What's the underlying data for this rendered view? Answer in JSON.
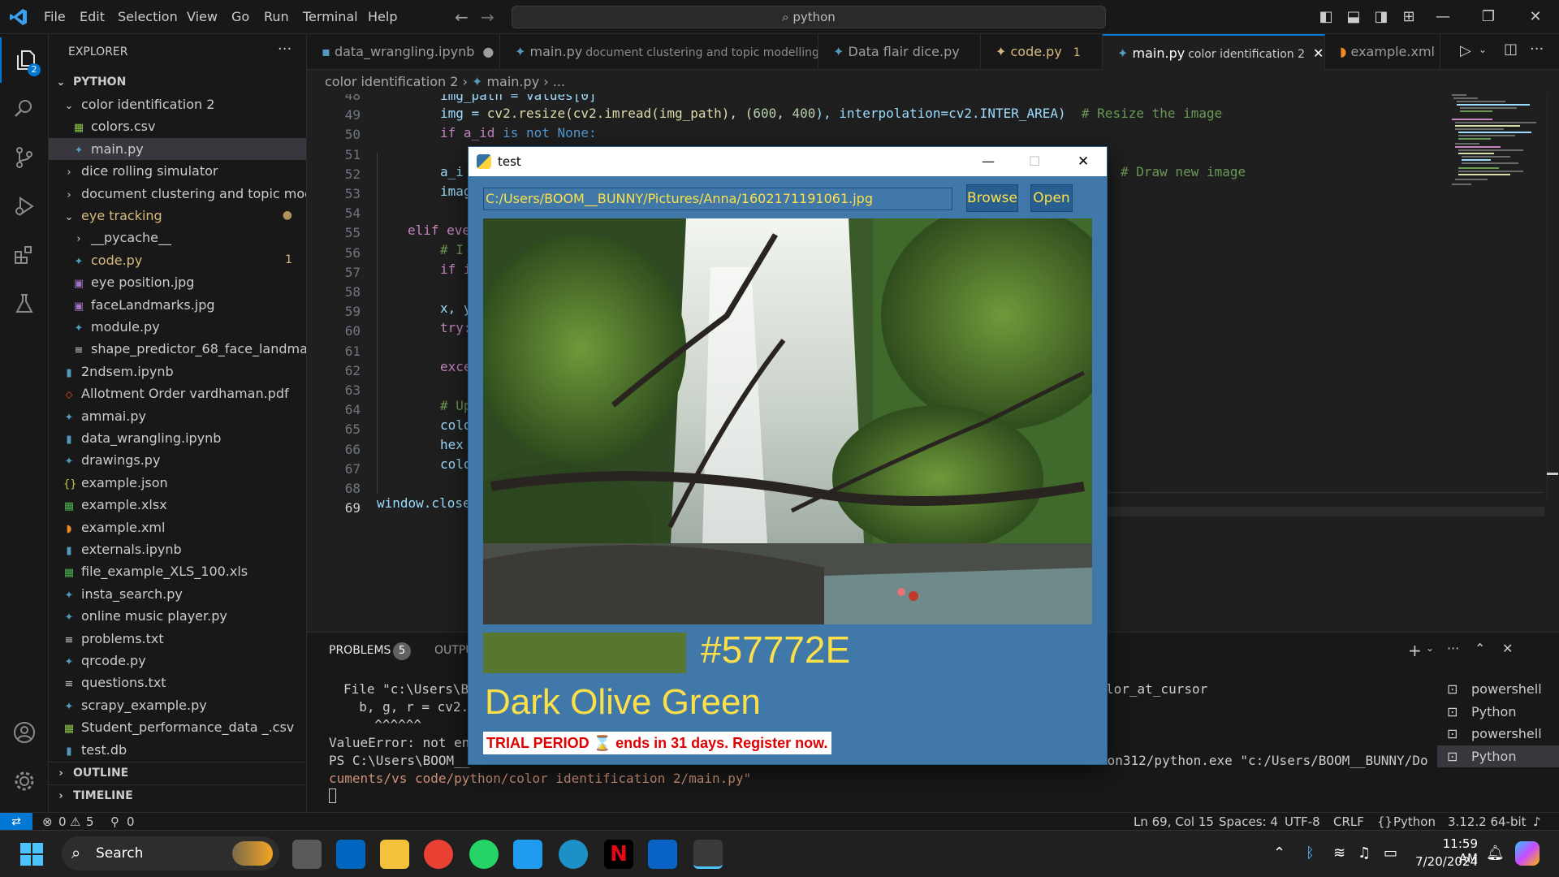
{
  "menu": [
    "File",
    "Edit",
    "Selection",
    "View",
    "Go",
    "Run",
    "Terminal",
    "Help"
  ],
  "command_center": "python",
  "explorer": {
    "title": "EXPLORER",
    "root": "PYTHON",
    "items": [
      {
        "label": "color identification 2",
        "type": "folder-open",
        "level": 1
      },
      {
        "label": "colors.csv",
        "type": "csv",
        "level": 2
      },
      {
        "label": "main.py",
        "type": "py",
        "level": 2,
        "selected": true
      },
      {
        "label": "dice rolling simulator",
        "type": "folder",
        "level": 1
      },
      {
        "label": "document clustering and topic mod...",
        "type": "folder",
        "level": 1
      },
      {
        "label": "eye tracking",
        "type": "folder-open",
        "level": 1,
        "modified": true
      },
      {
        "label": "__pycache__",
        "type": "folder",
        "level": 2
      },
      {
        "label": "code.py",
        "type": "py",
        "level": 2,
        "badge": "1",
        "warn": true
      },
      {
        "label": "eye position.jpg",
        "type": "img",
        "level": 2
      },
      {
        "label": "faceLandmarks.jpg",
        "type": "img",
        "level": 2
      },
      {
        "label": "module.py",
        "type": "py",
        "level": 2
      },
      {
        "label": "shape_predictor_68_face_landmark...",
        "type": "txt",
        "level": 2
      },
      {
        "label": "2ndsem.ipynb",
        "type": "nb",
        "level": 1
      },
      {
        "label": "Allotment Order vardhaman.pdf",
        "type": "pdf",
        "level": 1
      },
      {
        "label": "ammai.py",
        "type": "py",
        "level": 1
      },
      {
        "label": "data_wrangling.ipynb",
        "type": "nb",
        "level": 1
      },
      {
        "label": "drawings.py",
        "type": "py",
        "level": 1
      },
      {
        "label": "example.json",
        "type": "json",
        "level": 1
      },
      {
        "label": "example.xlsx",
        "type": "xls",
        "level": 1
      },
      {
        "label": "example.xml",
        "type": "xml",
        "level": 1
      },
      {
        "label": "externals.ipynb",
        "type": "nb",
        "level": 1
      },
      {
        "label": "file_example_XLS_100.xls",
        "type": "xls",
        "level": 1
      },
      {
        "label": "insta_search.py",
        "type": "py",
        "level": 1
      },
      {
        "label": "online music player.py",
        "type": "py",
        "level": 1
      },
      {
        "label": "problems.txt",
        "type": "txt",
        "level": 1
      },
      {
        "label": "qrcode.py",
        "type": "py",
        "level": 1
      },
      {
        "label": "questions.txt",
        "type": "txt",
        "level": 1
      },
      {
        "label": "scrapy_example.py",
        "type": "py",
        "level": 1
      },
      {
        "label": "Student_performance_data _.csv",
        "type": "csv",
        "level": 1
      },
      {
        "label": "test.db",
        "type": "nb",
        "level": 1
      }
    ],
    "outline": "OUTLINE",
    "timeline": "TIMELINE"
  },
  "tabs": [
    {
      "label": "data_wrangling.ipynb",
      "desc": "",
      "dirty": true
    },
    {
      "label": "main.py",
      "desc": "document clustering and topic modelling"
    },
    {
      "label": "Data flair dice.py",
      "desc": ""
    },
    {
      "label": "code.py",
      "desc": "1",
      "warn": true
    },
    {
      "label": "main.py",
      "desc": "color identification 2",
      "active": true
    },
    {
      "label": "example.xml",
      "desc": ""
    }
  ],
  "breadcrumb": [
    "color identification 2",
    "main.py",
    "..."
  ],
  "editor": {
    "lines": [
      "48",
      "49",
      "50",
      "51",
      "52",
      "53",
      "54",
      "55",
      "56",
      "57",
      "58",
      "59",
      "60",
      "61",
      "62",
      "63",
      "64",
      "65",
      "66",
      "67",
      "68",
      "69"
    ],
    "code": {
      "l48": "img_path = values[0]",
      "l49_a": "img = ",
      "l49_b": "cv2.resize(cv2.imread(img_path), (",
      "l49_c": "600",
      "l49_d": ", ",
      "l49_e": "400",
      "l49_f": "), interpolation=cv2.INTER_AREA)",
      "l49_cm": "# Resize the image",
      "l50_a": "if a_id ",
      "l50_b": "is not",
      "l50_c": " None:",
      "l52": "a_i",
      "l52_cm": "# Draw new image",
      "l53": "imag",
      "l55": "elif eve",
      "l56": "# I",
      "l57": "if i",
      "l59": "x, y",
      "l60": "try:",
      "l62": "exce",
      "l64": "# Up",
      "l65": "colo",
      "l66": "hex",
      "l67": "colo",
      "l69": "window.close"
    }
  },
  "panel": {
    "problems_label": "PROBLEMS",
    "problems_count": "5",
    "output_label": "OUTPU",
    "terminal_lines": [
      "File \"c:\\Users\\BO",
      "  b, g, r = cv2.s",
      "  ^^^^^^",
      "ValueError: not eno",
      "PS C:\\Users\\BOOM__B",
      "cuments/vs code/python/color identification 2/main.py\""
    ],
    "terminal_right": "lor_at_cursor",
    "terminal_cmd": "non312/python.exe \"c:/Users/BOOM__BUNNY/Do",
    "terminals": [
      "powershell",
      "Python",
      "powershell",
      "Python"
    ]
  },
  "status": {
    "errors": "0",
    "warnings": "5",
    "ports": "0",
    "position": "Ln 69, Col 15",
    "spaces": "Spaces: 4",
    "encoding": "UTF-8",
    "eol": "CRLF",
    "language": "Python",
    "interpreter": "3.12.2 64-bit"
  },
  "dialog": {
    "title": "test",
    "path": "C:/Users/BOOM__BUNNY/Pictures/Anna/1602171191061.jpg",
    "browse": "Browse",
    "open": "Open",
    "swatch_color": "#57772E",
    "hex": "#57772E",
    "color_name": "Dark Olive Green",
    "trial": "TRIAL PERIOD ⌛ ends in 31 days. Register now."
  },
  "taskbar": {
    "search": "Search",
    "time": "11:59 AM",
    "date": "7/20/2024"
  },
  "colors": {
    "accent": "#0078d4",
    "dialog_bg": "#3f78a9",
    "yellow_text": "#fde047"
  }
}
